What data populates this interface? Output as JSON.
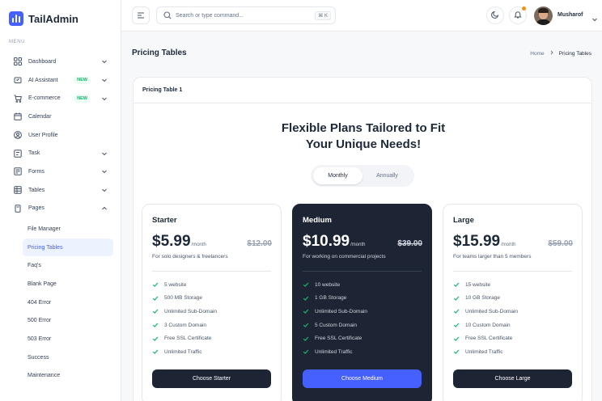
{
  "brand": {
    "name": "TailAdmin"
  },
  "sidebar": {
    "menu_label": "MENU",
    "items": [
      {
        "label": "Dashboard",
        "icon": "grid-icon",
        "chevron": "down"
      },
      {
        "label": "AI Assistant",
        "icon": "ai-icon",
        "badge": "NEW",
        "chevron": "down"
      },
      {
        "label": "E-commerce",
        "icon": "cart-icon",
        "badge": "NEW",
        "chevron": "down"
      },
      {
        "label": "Calendar",
        "icon": "calendar-icon"
      },
      {
        "label": "User Profile",
        "icon": "user-icon"
      },
      {
        "label": "Task",
        "icon": "task-icon",
        "chevron": "down"
      },
      {
        "label": "Forms",
        "icon": "forms-icon",
        "chevron": "down"
      },
      {
        "label": "Tables",
        "icon": "table-icon",
        "chevron": "down"
      },
      {
        "label": "Pages",
        "icon": "pages-icon",
        "chevron": "up"
      }
    ],
    "sub_items": [
      {
        "label": "File Manager"
      },
      {
        "label": "Pricing Tables",
        "active": true
      },
      {
        "label": "Faq's"
      },
      {
        "label": "Blank Page"
      },
      {
        "label": "404 Error"
      },
      {
        "label": "500 Error"
      },
      {
        "label": "503 Error"
      },
      {
        "label": "Success"
      },
      {
        "label": "Maintenance"
      }
    ]
  },
  "header": {
    "search_placeholder": "Search or type command...",
    "search_shortcut": "⌘ K",
    "user_name": "Musharof"
  },
  "page": {
    "title": "Pricing Tables",
    "breadcrumb": {
      "home": "Home",
      "current": "Pricing Tables"
    }
  },
  "panel": {
    "title": "Pricing Table 1",
    "heading_line1": "Flexible Plans Tailored to Fit",
    "heading_line2": "Your Unique Needs!",
    "toggle": {
      "monthly": "Monthly",
      "annually": "Annually",
      "selected": "Monthly"
    }
  },
  "plans": [
    {
      "name": "Starter",
      "price": "$5.99",
      "period": "/month",
      "old_price": "$12.00",
      "description": "For solo designers & freelancers",
      "features": [
        "5 website",
        "500 MB Storage",
        "Unlimited Sub-Domain",
        "3 Custom Domain",
        "Free SSL Certificate",
        "Unlimited Traffic"
      ],
      "button": "Choose Starter"
    },
    {
      "name": "Medium",
      "price": "$10.99",
      "period": "/month",
      "old_price": "$39.00",
      "description": "For working on commercial projects",
      "features": [
        "10 website",
        "1 GB Storage",
        "Unlimited Sub-Domain",
        "5 Custom Domain",
        "Free SSL Certificate",
        "Unlimited Traffic"
      ],
      "button": "Choose Medium"
    },
    {
      "name": "Large",
      "price": "$15.99",
      "period": "/month",
      "old_price": "$59.00",
      "description": "For teams larger than 5 members",
      "features": [
        "15 website",
        "10 GB Storage",
        "Unlimited Sub-Domain",
        "10 Custom Domain",
        "Free SSL Certificate",
        "Unlimited Traffic"
      ],
      "button": "Choose Large"
    }
  ],
  "colors": {
    "accent": "#465fff",
    "dark_card": "#1d2433",
    "check": "#12b76a",
    "badge_text": "#12b76a"
  }
}
